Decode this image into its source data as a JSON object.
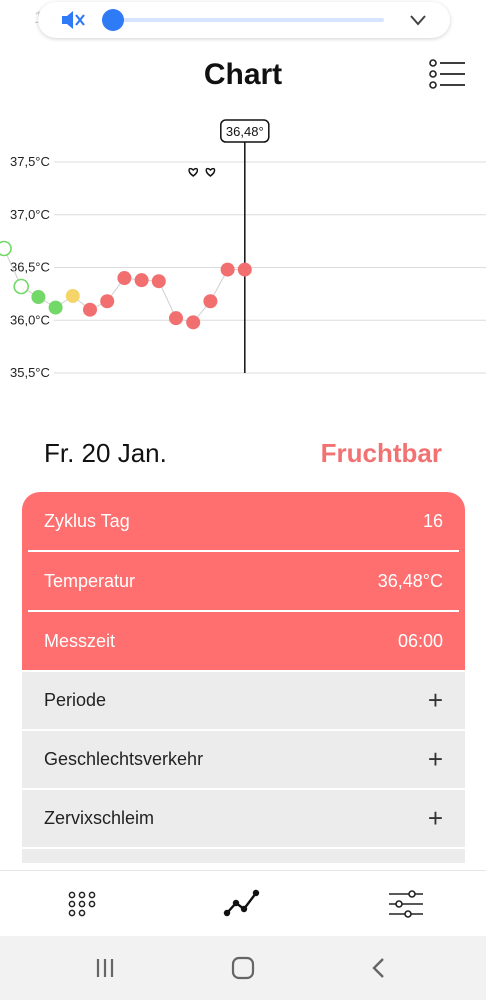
{
  "status_bar": {
    "time": "13"
  },
  "volume": {
    "level": 0.0,
    "muted_icon": "speaker-muted-icon"
  },
  "header": {
    "title": "Chart",
    "menu_icon": "list-menu-icon"
  },
  "chart_data": {
    "type": "line",
    "ylabel_ticks": [
      "37,5°C",
      "37,0°C",
      "36,5°C",
      "36,0°C",
      "35,5°C"
    ],
    "ylim": [
      35.5,
      37.5
    ],
    "selected_label": "36,48°",
    "points": [
      {
        "day": 1,
        "value": 36.68,
        "status": "green-outline"
      },
      {
        "day": 2,
        "value": 36.32,
        "status": "green-outline"
      },
      {
        "day": 3,
        "value": 36.22,
        "status": "green"
      },
      {
        "day": 4,
        "value": 36.12,
        "status": "green"
      },
      {
        "day": 5,
        "value": 36.23,
        "status": "yellow"
      },
      {
        "day": 6,
        "value": 36.1,
        "status": "red"
      },
      {
        "day": 7,
        "value": 36.18,
        "status": "red"
      },
      {
        "day": 8,
        "value": 36.4,
        "status": "red"
      },
      {
        "day": 9,
        "value": 36.38,
        "status": "red"
      },
      {
        "day": 10,
        "value": 36.37,
        "status": "red"
      },
      {
        "day": 11,
        "value": 36.02,
        "status": "red"
      },
      {
        "day": 12,
        "value": 35.98,
        "status": "red"
      },
      {
        "day": 13,
        "value": 36.18,
        "status": "red"
      },
      {
        "day": 14,
        "value": 36.48,
        "status": "red"
      },
      {
        "day": 15,
        "value": 36.48,
        "status": "red"
      }
    ],
    "heart_days": [
      12,
      13
    ],
    "selected_day": 15,
    "grid": true,
    "colors": {
      "red": "#f26f6f",
      "green": "#72d868",
      "yellow": "#f5d56a",
      "grid": "#dcdcdc"
    }
  },
  "day_info": {
    "date": "Fr. 20 Jan.",
    "status": "Fruchtbar"
  },
  "card": {
    "rows": [
      {
        "label": "Zyklus Tag",
        "value": "16"
      },
      {
        "label": "Temperatur",
        "value": "36,48°C"
      },
      {
        "label": "Messzeit",
        "value": "06:00"
      }
    ]
  },
  "list": {
    "items": [
      {
        "label": "Periode",
        "action": "+"
      },
      {
        "label": "Geschlechtsverkehr",
        "action": "+"
      },
      {
        "label": "Zervixschleim",
        "action": "+"
      }
    ]
  },
  "bottom_nav": [
    "dots-grid-icon",
    "chart-line-icon",
    "sliders-icon"
  ],
  "colors": {
    "accent": "#ff6f6f",
    "accent_text": "#f27272",
    "list_bg": "#ececec"
  }
}
